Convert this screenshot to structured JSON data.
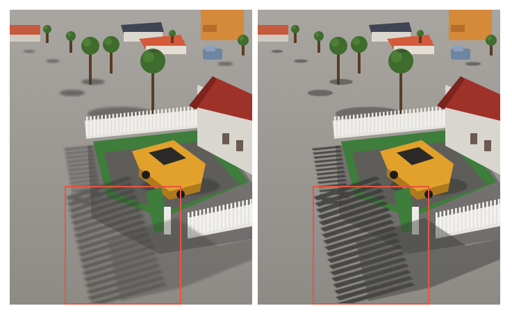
{
  "figure": {
    "panels": [
      {
        "id": "left",
        "description_name": "render-left",
        "highlight_color": "#e8553f",
        "shadow_style": "soft"
      },
      {
        "id": "right",
        "description_name": "render-right",
        "highlight_color": "#e8553f",
        "shadow_style": "hard"
      }
    ],
    "colors": {
      "ground": "#8f8b86",
      "lawn": "#3e7d3b",
      "car": "#e1a12b",
      "roof": "#9e3128",
      "wall": "#d9d6cf",
      "fence": "#e6e4df",
      "tree_canopy": "#3f6b2d",
      "trunk": "#5a3b22",
      "shadow": "#3b3a38",
      "highlight": "#e8553f"
    }
  }
}
